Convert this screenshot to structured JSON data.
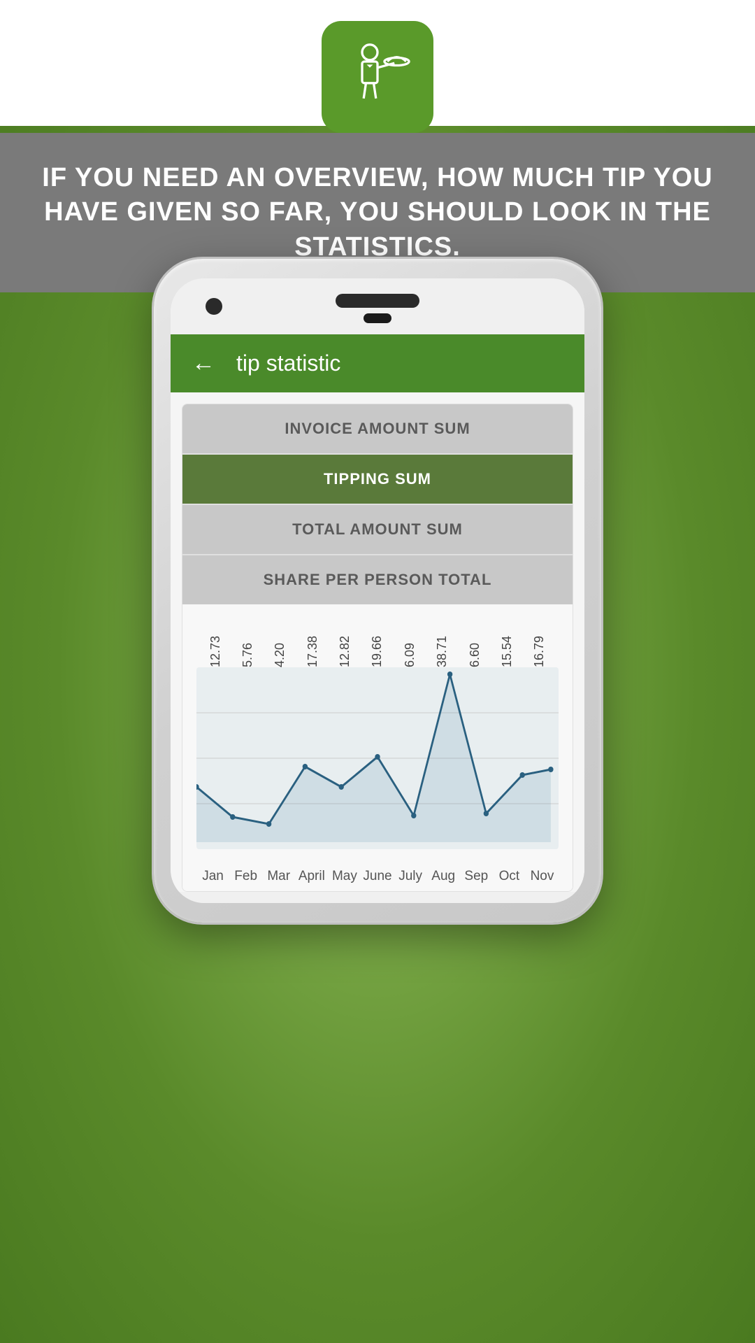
{
  "app": {
    "icon_label": "waiter-tip-icon",
    "banner_text": "IF YOU NEED AN OVERVIEW, HOW MUCH TIP YOU HAVE GIVEN SO FAR, YOU SHOULD LOOK IN THE STATISTICS.",
    "header": {
      "back_label": "←",
      "title": "tip statistic"
    },
    "filters": [
      {
        "id": "invoice",
        "label": "INVOICE AMOUNT SUM",
        "active": false
      },
      {
        "id": "tipping",
        "label": "TIPPING SUM",
        "active": true
      },
      {
        "id": "total",
        "label": "TOTAL AMOUNT SUM",
        "active": false
      },
      {
        "id": "share",
        "label": "SHARE PER PERSON TOTAL",
        "active": false
      }
    ],
    "chart": {
      "y_values": [
        "12.73",
        "5.76",
        "4.20",
        "17.38",
        "12.82",
        "19.66",
        "6.09",
        "38.71",
        "6.60",
        "15.54",
        "16.79"
      ],
      "x_labels": [
        "Jan",
        "Feb",
        "Mar",
        "April",
        "May",
        "June",
        "July",
        "Aug",
        "Sep",
        "Oct",
        "Nov"
      ]
    }
  }
}
